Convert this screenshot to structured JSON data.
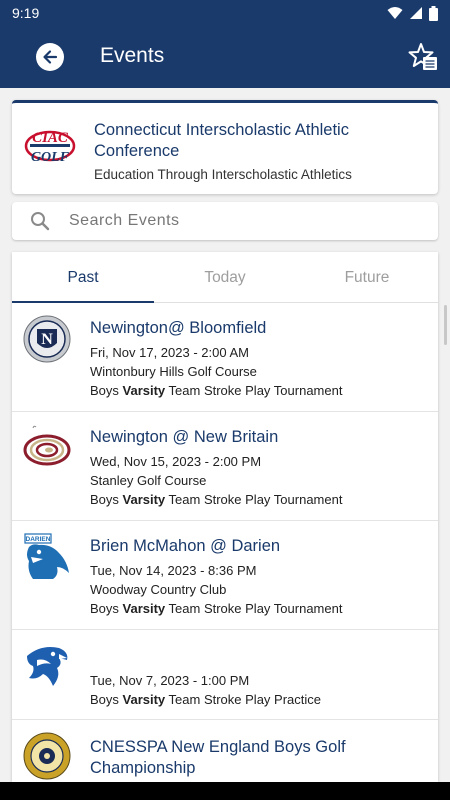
{
  "status": {
    "time": "9:19"
  },
  "header": {
    "title": "Events"
  },
  "conference": {
    "name": "Connecticut Interscholastic Athletic Conference",
    "tagline": "Education Through Interscholastic Athletics",
    "logo_text_top": "CIAC",
    "logo_text_bottom": "GOLF"
  },
  "search": {
    "placeholder": "Search Events"
  },
  "tabs": [
    {
      "label": "Past",
      "active": true
    },
    {
      "label": "Today",
      "active": false
    },
    {
      "label": "Future",
      "active": false
    }
  ],
  "events": [
    {
      "title": "Newington@ Bloomfield",
      "date": "Fri, Nov 17, 2023 - 2:00 AM",
      "venue": "Wintonbury Hills Golf Course",
      "type_pre": "Boys ",
      "type_level": "Varsity",
      "type_post": " Team Stroke Play Tournament",
      "logo": "newington-logo"
    },
    {
      "title": "Newington @ New Britain",
      "date": "Wed, Nov 15, 2023 - 2:00 PM",
      "venue": "Stanley Golf Course",
      "type_pre": "Boys ",
      "type_level": "Varsity",
      "type_post": " Team Stroke Play Tournament",
      "logo": "new-britain-logo"
    },
    {
      "title": "Brien McMahon @ Darien",
      "date": "Tue, Nov 14, 2023 - 8:36 PM",
      "venue": "Woodway Country Club",
      "type_pre": "Boys ",
      "type_level": "Varsity",
      "type_post": " Team Stroke Play Tournament",
      "logo": "darien-logo",
      "logo_text": "DARIEN"
    },
    {
      "title": "",
      "date": "Tue, Nov 7, 2023 - 1:00 PM",
      "venue": "",
      "type_pre": "Boys ",
      "type_level": "Varsity",
      "type_post": " Team Stroke Play Practice",
      "logo": "eagle-logo"
    },
    {
      "title": "CNESSPA New England Boys Golf Championship",
      "date": "",
      "venue": "",
      "logo": "cnesspa-logo"
    }
  ],
  "colors": {
    "primary": "#1a3a6b",
    "background": "#f1f1f1"
  }
}
